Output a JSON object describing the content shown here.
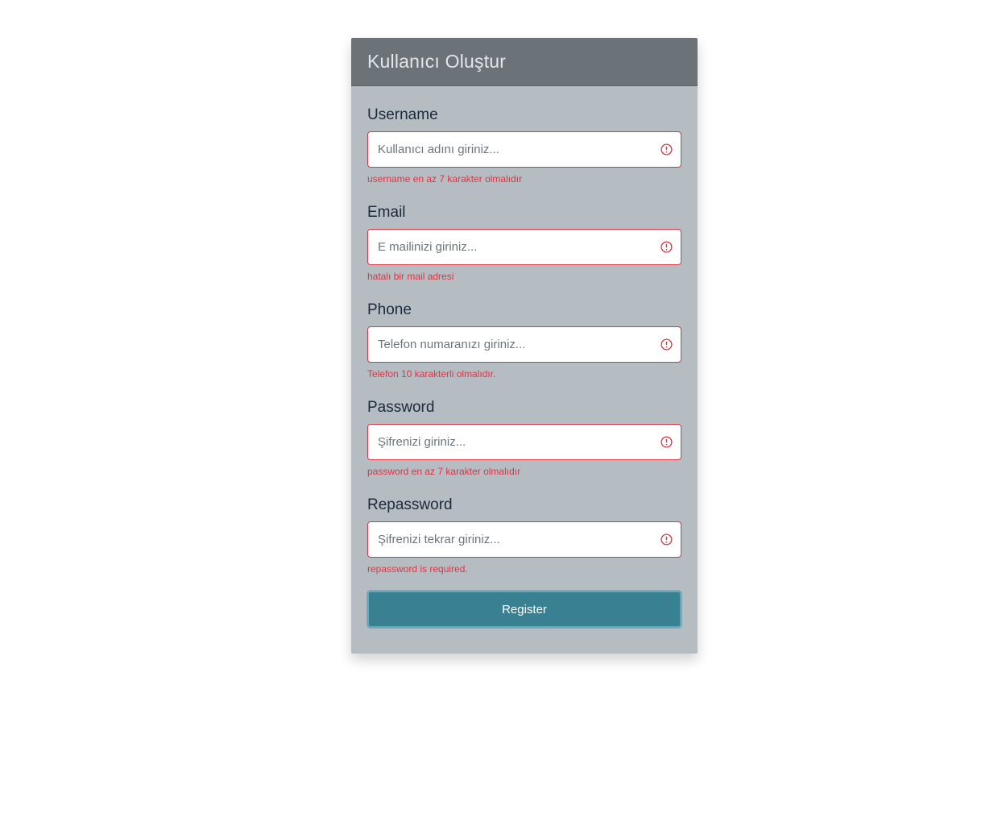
{
  "header": {
    "title": "Kullanıcı Oluştur"
  },
  "form": {
    "fields": [
      {
        "label": "Username",
        "placeholder": "Kullanıcı adını giriniz...",
        "value": "",
        "error": "username en az 7 karakter olmalıdır",
        "icon": "exclamation-circle-icon"
      },
      {
        "label": "Email",
        "placeholder": "E mailinizi giriniz...",
        "value": "",
        "error": "hatalı bir mail adresi",
        "icon": "exclamation-circle-icon"
      },
      {
        "label": "Phone",
        "placeholder": "Telefon numaranızı giriniz...",
        "value": "",
        "error": "Telefon 10 karakterli olmalıdır.",
        "icon": "exclamation-circle-icon"
      },
      {
        "label": "Password",
        "placeholder": "Şifrenizi giriniz...",
        "value": "",
        "error": "password en az 7 karakter olmalıdır",
        "icon": "exclamation-circle-icon"
      },
      {
        "label": "Repassword",
        "placeholder": "Şifrenizi tekrar giriniz...",
        "value": "",
        "error": "repassword is required.",
        "icon": "exclamation-circle-icon"
      }
    ],
    "submit_label": "Register"
  },
  "colors": {
    "page_background": "#ffffff",
    "card_background": "#b5bdc3",
    "header_background": "#6b7278",
    "error": "#dc3545",
    "button": "#3a8093"
  }
}
